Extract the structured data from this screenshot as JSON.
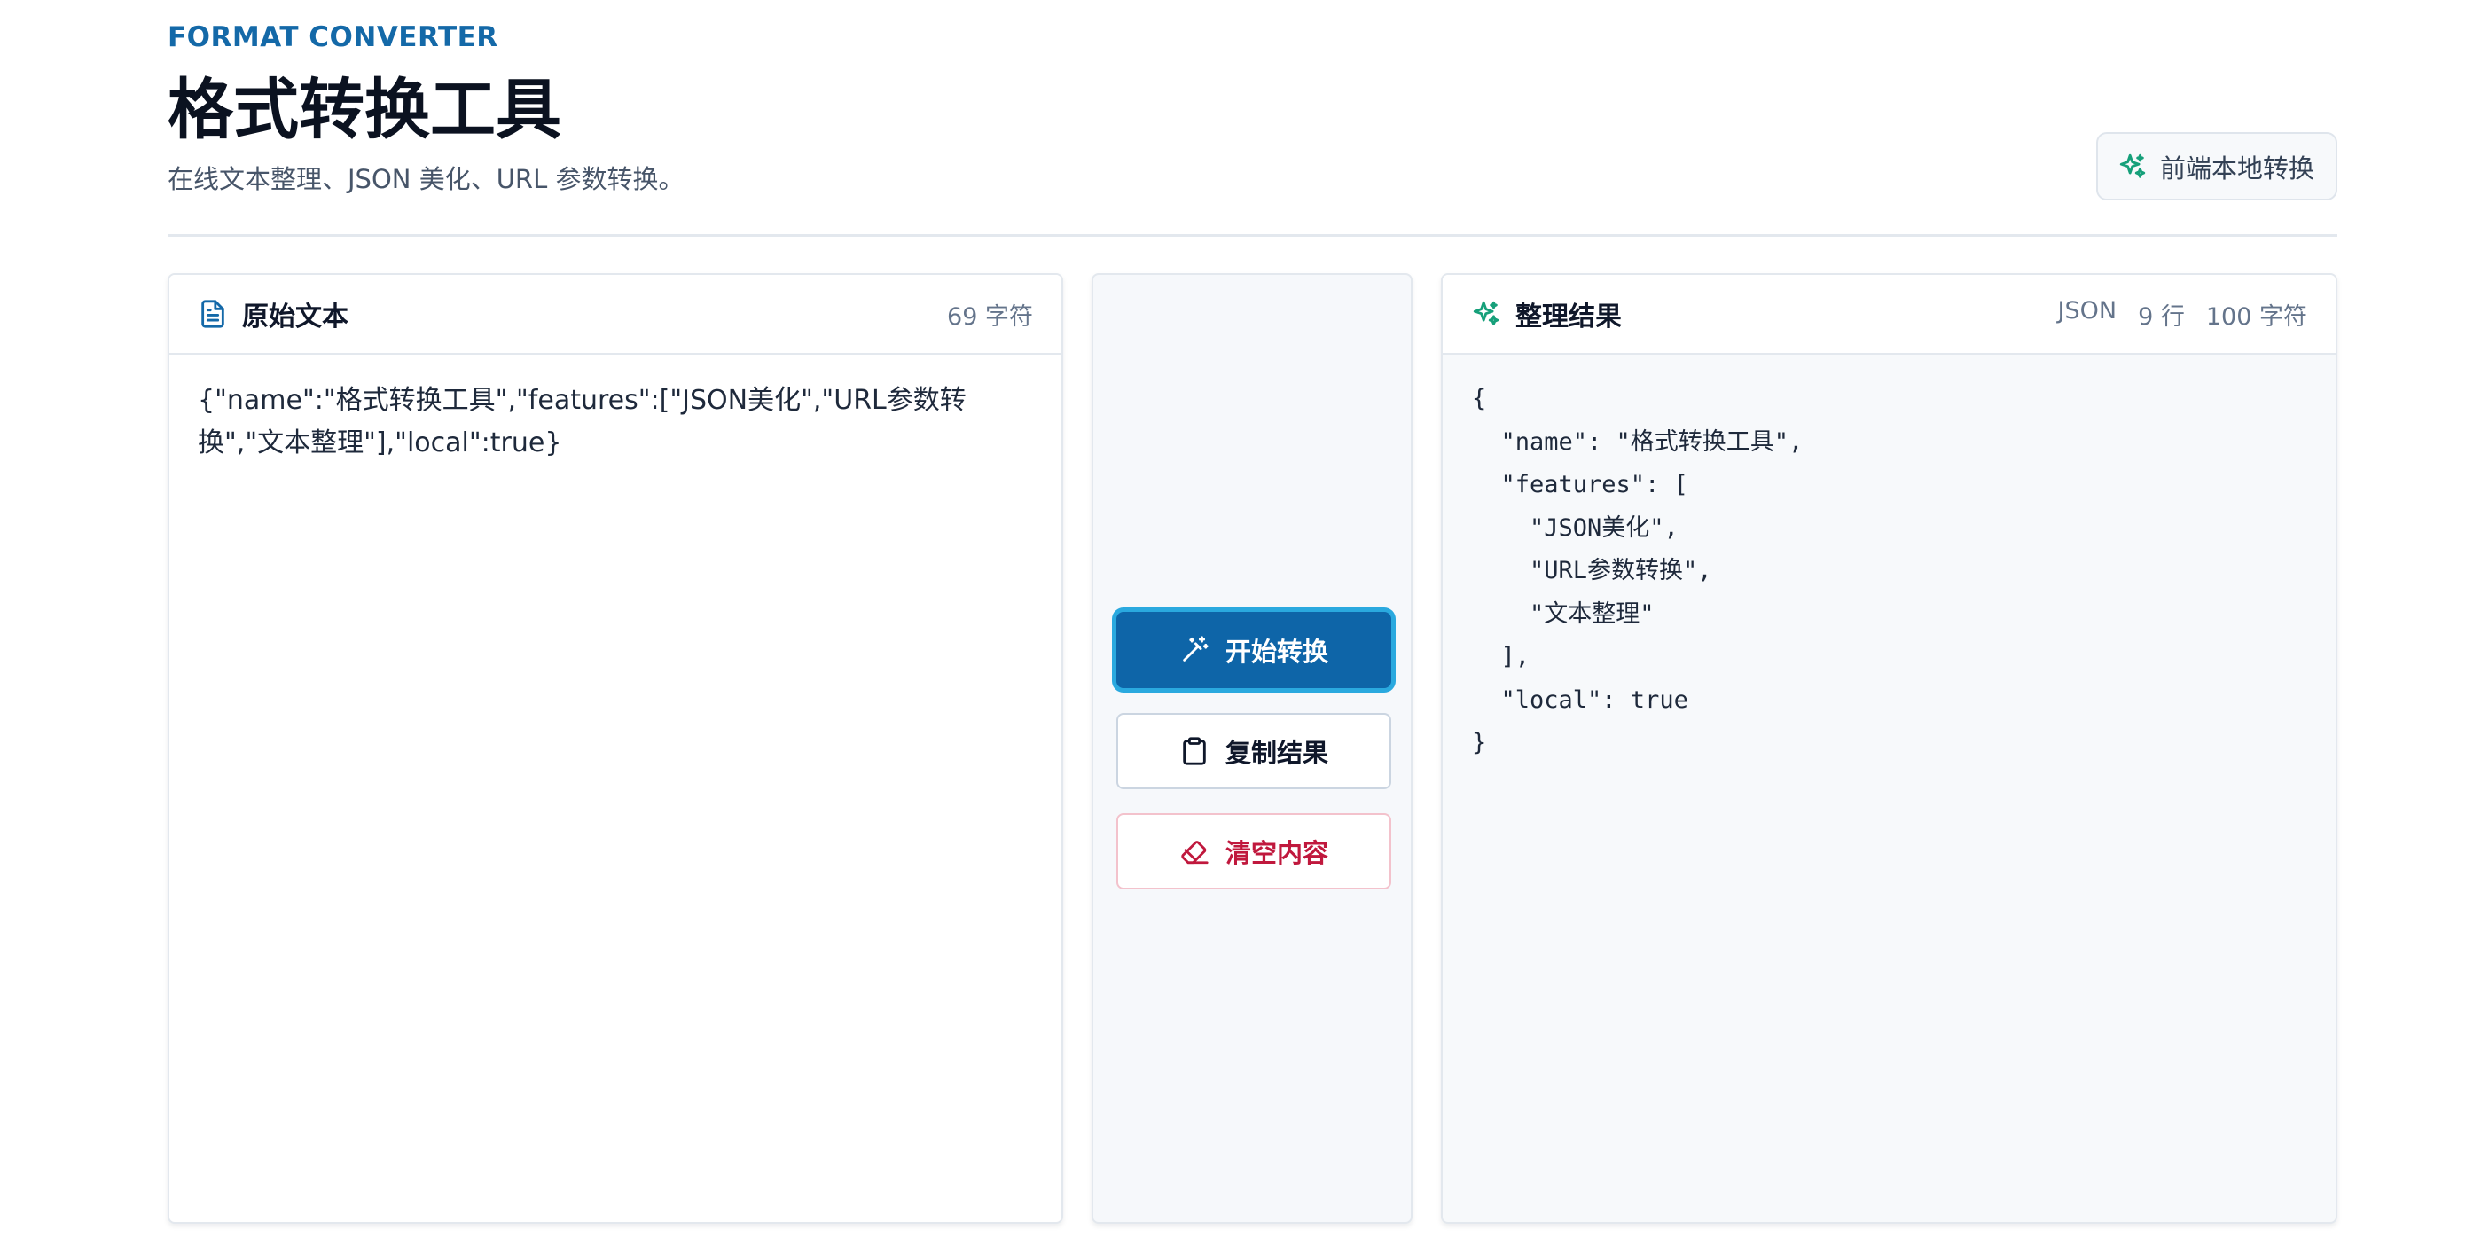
{
  "header": {
    "kicker": "FORMAT CONVERTER",
    "title": "格式转换工具",
    "subtitle": "在线文本整理、JSON 美化、URL 参数转换。",
    "badge_label": "前端本地转换",
    "badge_icon": "sparkles-icon"
  },
  "source_panel": {
    "title": "原始文本",
    "icon": "document-icon",
    "char_count": "69 字符",
    "text": "{\"name\":\"格式转换工具\",\"features\":[\"JSON美化\",\"URL参数转换\",\"文本整理\"],\"local\":true}"
  },
  "actions": {
    "convert_label": "开始转换",
    "convert_icon": "magic-wand-icon",
    "copy_label": "复制结果",
    "copy_icon": "clipboard-icon",
    "clear_label": "清空内容",
    "clear_icon": "eraser-icon"
  },
  "result_panel": {
    "title": "整理结果",
    "icon": "sparkles-icon",
    "format": "JSON",
    "line_count": "9 行",
    "char_count": "100 字符",
    "text": "{\n  \"name\": \"格式转换工具\",\n  \"features\": [\n    \"JSON美化\",\n    \"URL参数转换\",\n    \"文本整理\"\n  ],\n  \"local\": true\n}"
  },
  "colors": {
    "accent": "#0e65a8",
    "focus_ring": "#2aa9df",
    "success_icon": "#16a07a",
    "danger": "#c0183d"
  }
}
